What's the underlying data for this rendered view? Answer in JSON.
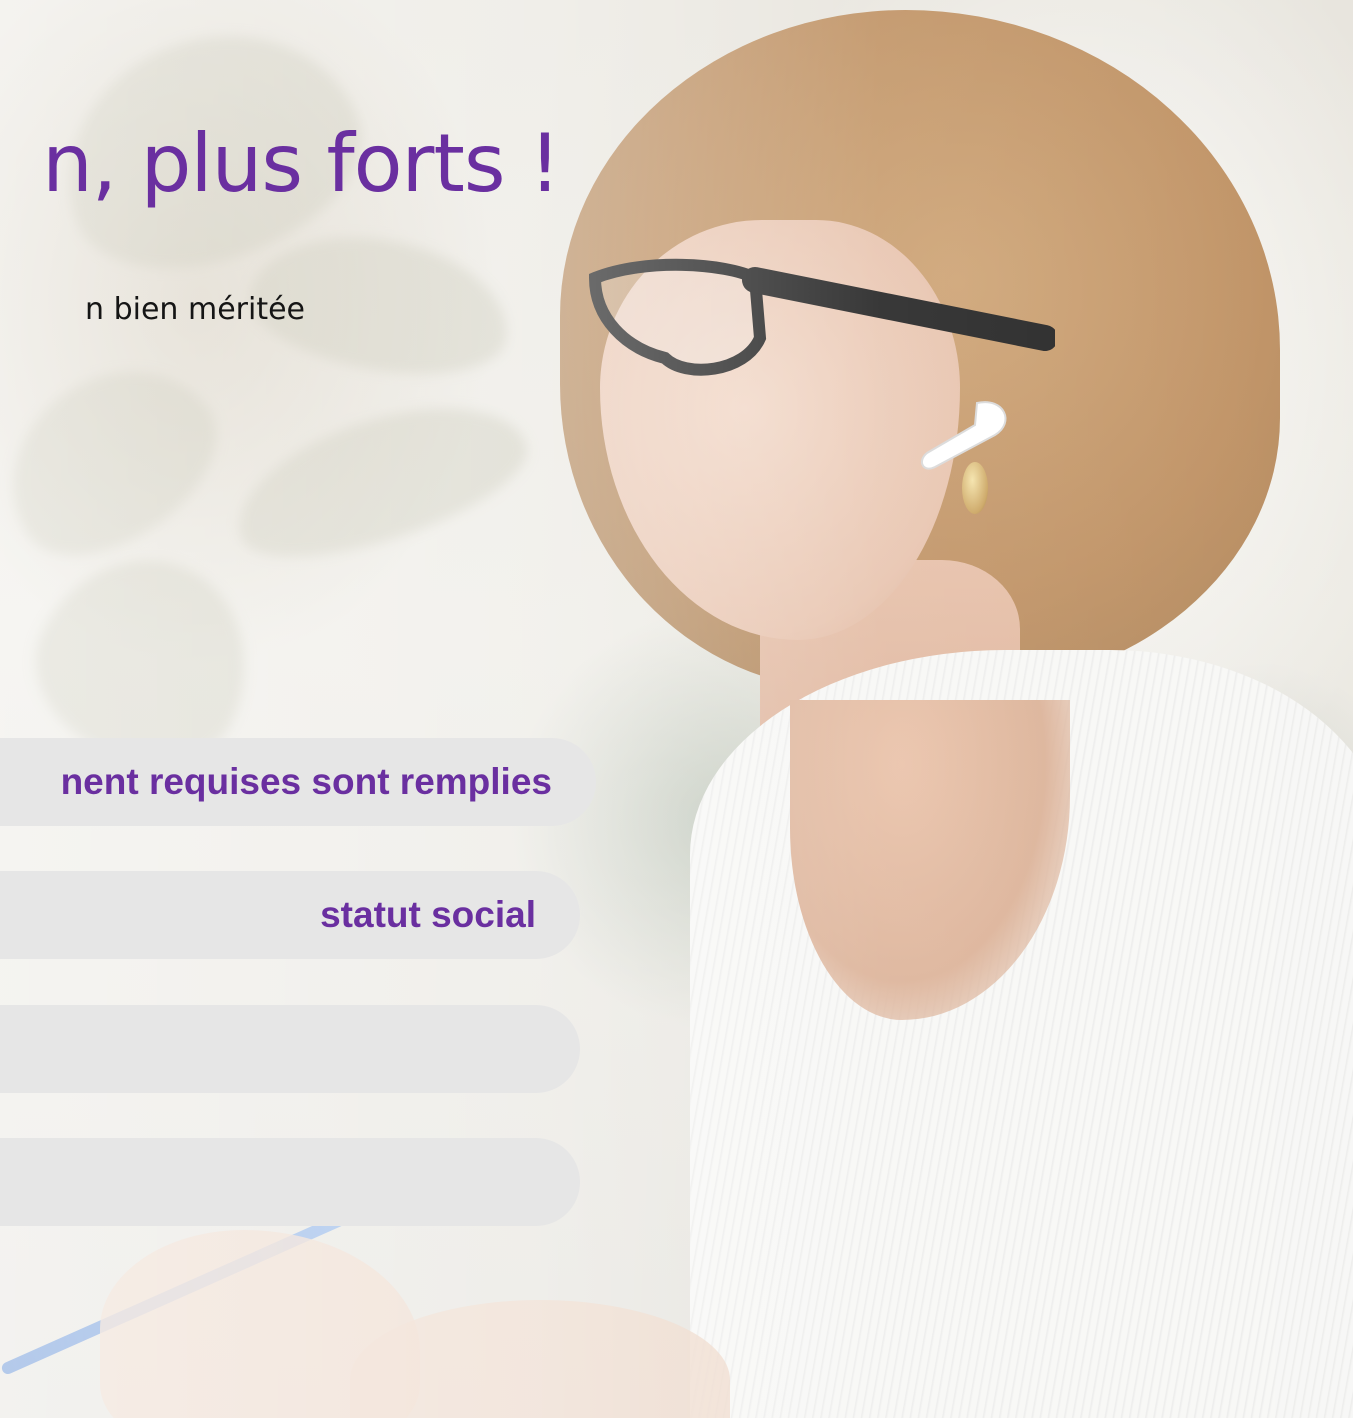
{
  "hero": {
    "image": "woman-with-glasses-and-earbud-photo",
    "heading": "n, plus forts !",
    "subheading": "n bien méritée"
  },
  "conditions": {
    "items": [
      {
        "label": "nent requises sont remplies"
      },
      {
        "label": "statut social"
      },
      {
        "label": ""
      },
      {
        "label": ""
      }
    ]
  },
  "colors": {
    "accent": "#6a2fa0",
    "pill_background": "#e6e6e6",
    "text_dark": "#151515"
  }
}
